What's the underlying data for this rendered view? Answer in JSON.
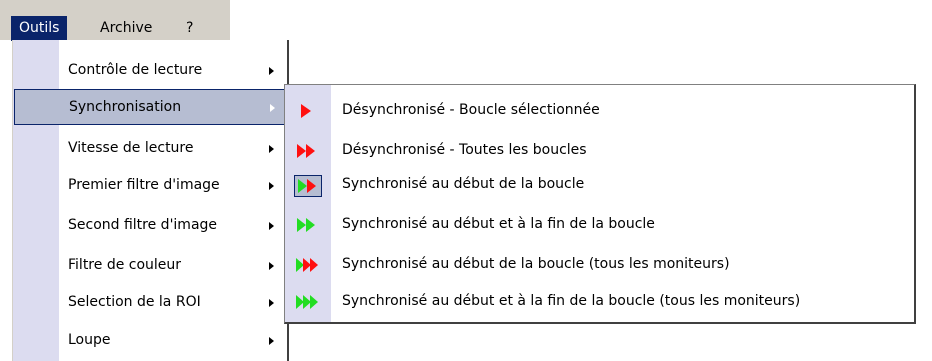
{
  "menubar": {
    "items": [
      {
        "label": "Outils",
        "mnemonic": "O",
        "rest": "utils"
      },
      {
        "label": "Archive",
        "mnemonic": "A",
        "rest": "rchive"
      },
      {
        "label": "?",
        "mnemonic": "?",
        "rest": ""
      }
    ]
  },
  "tools_menu": {
    "items": [
      {
        "label": "Contrôle de lecture",
        "has_submenu": true
      },
      {
        "label": "Synchronisation",
        "has_submenu": true,
        "selected": true
      },
      {
        "label": "Vitesse de lecture",
        "has_submenu": true
      },
      {
        "label": "Premier filtre d'image",
        "has_submenu": true
      },
      {
        "label": "Second filtre d'image",
        "has_submenu": true
      },
      {
        "label": "Filtre de couleur",
        "has_submenu": true
      },
      {
        "label": "Selection de la ROI",
        "has_submenu": true
      },
      {
        "label": "Loupe",
        "has_submenu": true
      }
    ]
  },
  "sync_menu": {
    "items": [
      {
        "label": "Désynchronisé - Boucle sélectionnée",
        "icon": "red-single-arrow-icon"
      },
      {
        "label": "Désynchronisé - Toutes les boucles",
        "icon": "red-double-arrow-icon"
      },
      {
        "label": "Synchronisé au début de la boucle",
        "icon": "green-red-arrow-icon",
        "checked": true
      },
      {
        "label": "Synchronisé au début et à la fin de la boucle",
        "icon": "green-double-arrow-icon"
      },
      {
        "label": "Synchronisé au début de la boucle (tous les moniteurs)",
        "icon": "green-red-triple-arrow-icon"
      },
      {
        "label": "Synchronisé au début et à la fin de la boucle (tous les moniteurs)",
        "icon": "green-triple-arrow-icon"
      }
    ]
  },
  "colors": {
    "highlight": "#0a246a",
    "menu_strip": "#dcdcf0",
    "arrow_red": "#ff1010",
    "arrow_green": "#22dd22"
  }
}
